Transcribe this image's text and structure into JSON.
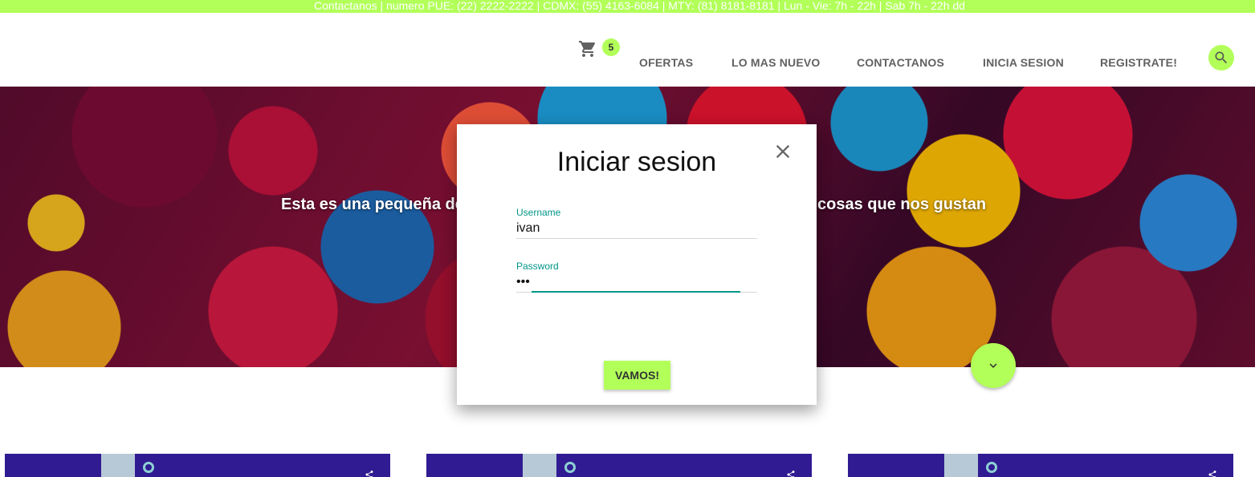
{
  "topbar": {
    "text": "Contactanos | numero PUE: (22) 2222-2222 | CDMX: (55) 4163-6084 | MTY: (81) 8181-8181 | Lun - Vie: 7h - 22h | Sab 7h - 22h dd"
  },
  "nav": {
    "cart_icon": "shopping-cart-icon",
    "cart_count": "5",
    "links": [
      "OFERTAS",
      "LO MAS NUEVO",
      "CONTACTANOS",
      "INICIA SESION",
      "REGISTRATE!"
    ],
    "search_icon": "search-icon"
  },
  "hero": {
    "text_left": "Esta es una pequeña de",
    "text_right": "cosas que nos gustan",
    "scroll_icon": "chevron-down-icon"
  },
  "modal": {
    "title": "Iniciar sesion",
    "close_icon": "close-icon",
    "username_label": "Username",
    "username_value": "ivan",
    "password_label": "Password",
    "password_value": "•••",
    "submit_label": "VAMOS!"
  },
  "cards": [
    {
      "share_icon": "share-icon"
    },
    {
      "share_icon": "share-icon"
    },
    {
      "share_icon": "share-icon"
    }
  ],
  "colors": {
    "accent": "#b2ff59",
    "input_focus": "#009688",
    "card_bg": "#311b92",
    "nav_text": "#616161"
  }
}
